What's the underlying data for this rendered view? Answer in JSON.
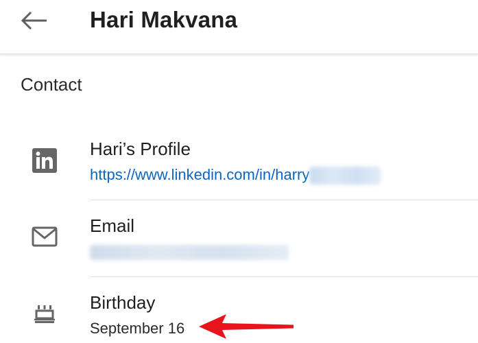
{
  "header": {
    "title": "Hari Makvana",
    "back_icon": "arrow-left-icon"
  },
  "section": {
    "title": "Contact"
  },
  "contacts": [
    {
      "icon": "linkedin-icon",
      "label": "Hari’s Profile",
      "value": "https://www.linkedin.com/in/harry",
      "value_redacted": true
    },
    {
      "icon": "mail-icon",
      "label": "Email",
      "value": "",
      "value_redacted": true
    },
    {
      "icon": "birthday-cake-icon",
      "label": "Birthday",
      "value": "September 16"
    }
  ],
  "annotation": {
    "icon": "red-arrow-icon",
    "color": "#e8141c"
  },
  "colors": {
    "link": "#0a66c2",
    "icon_gray": "#666666"
  }
}
